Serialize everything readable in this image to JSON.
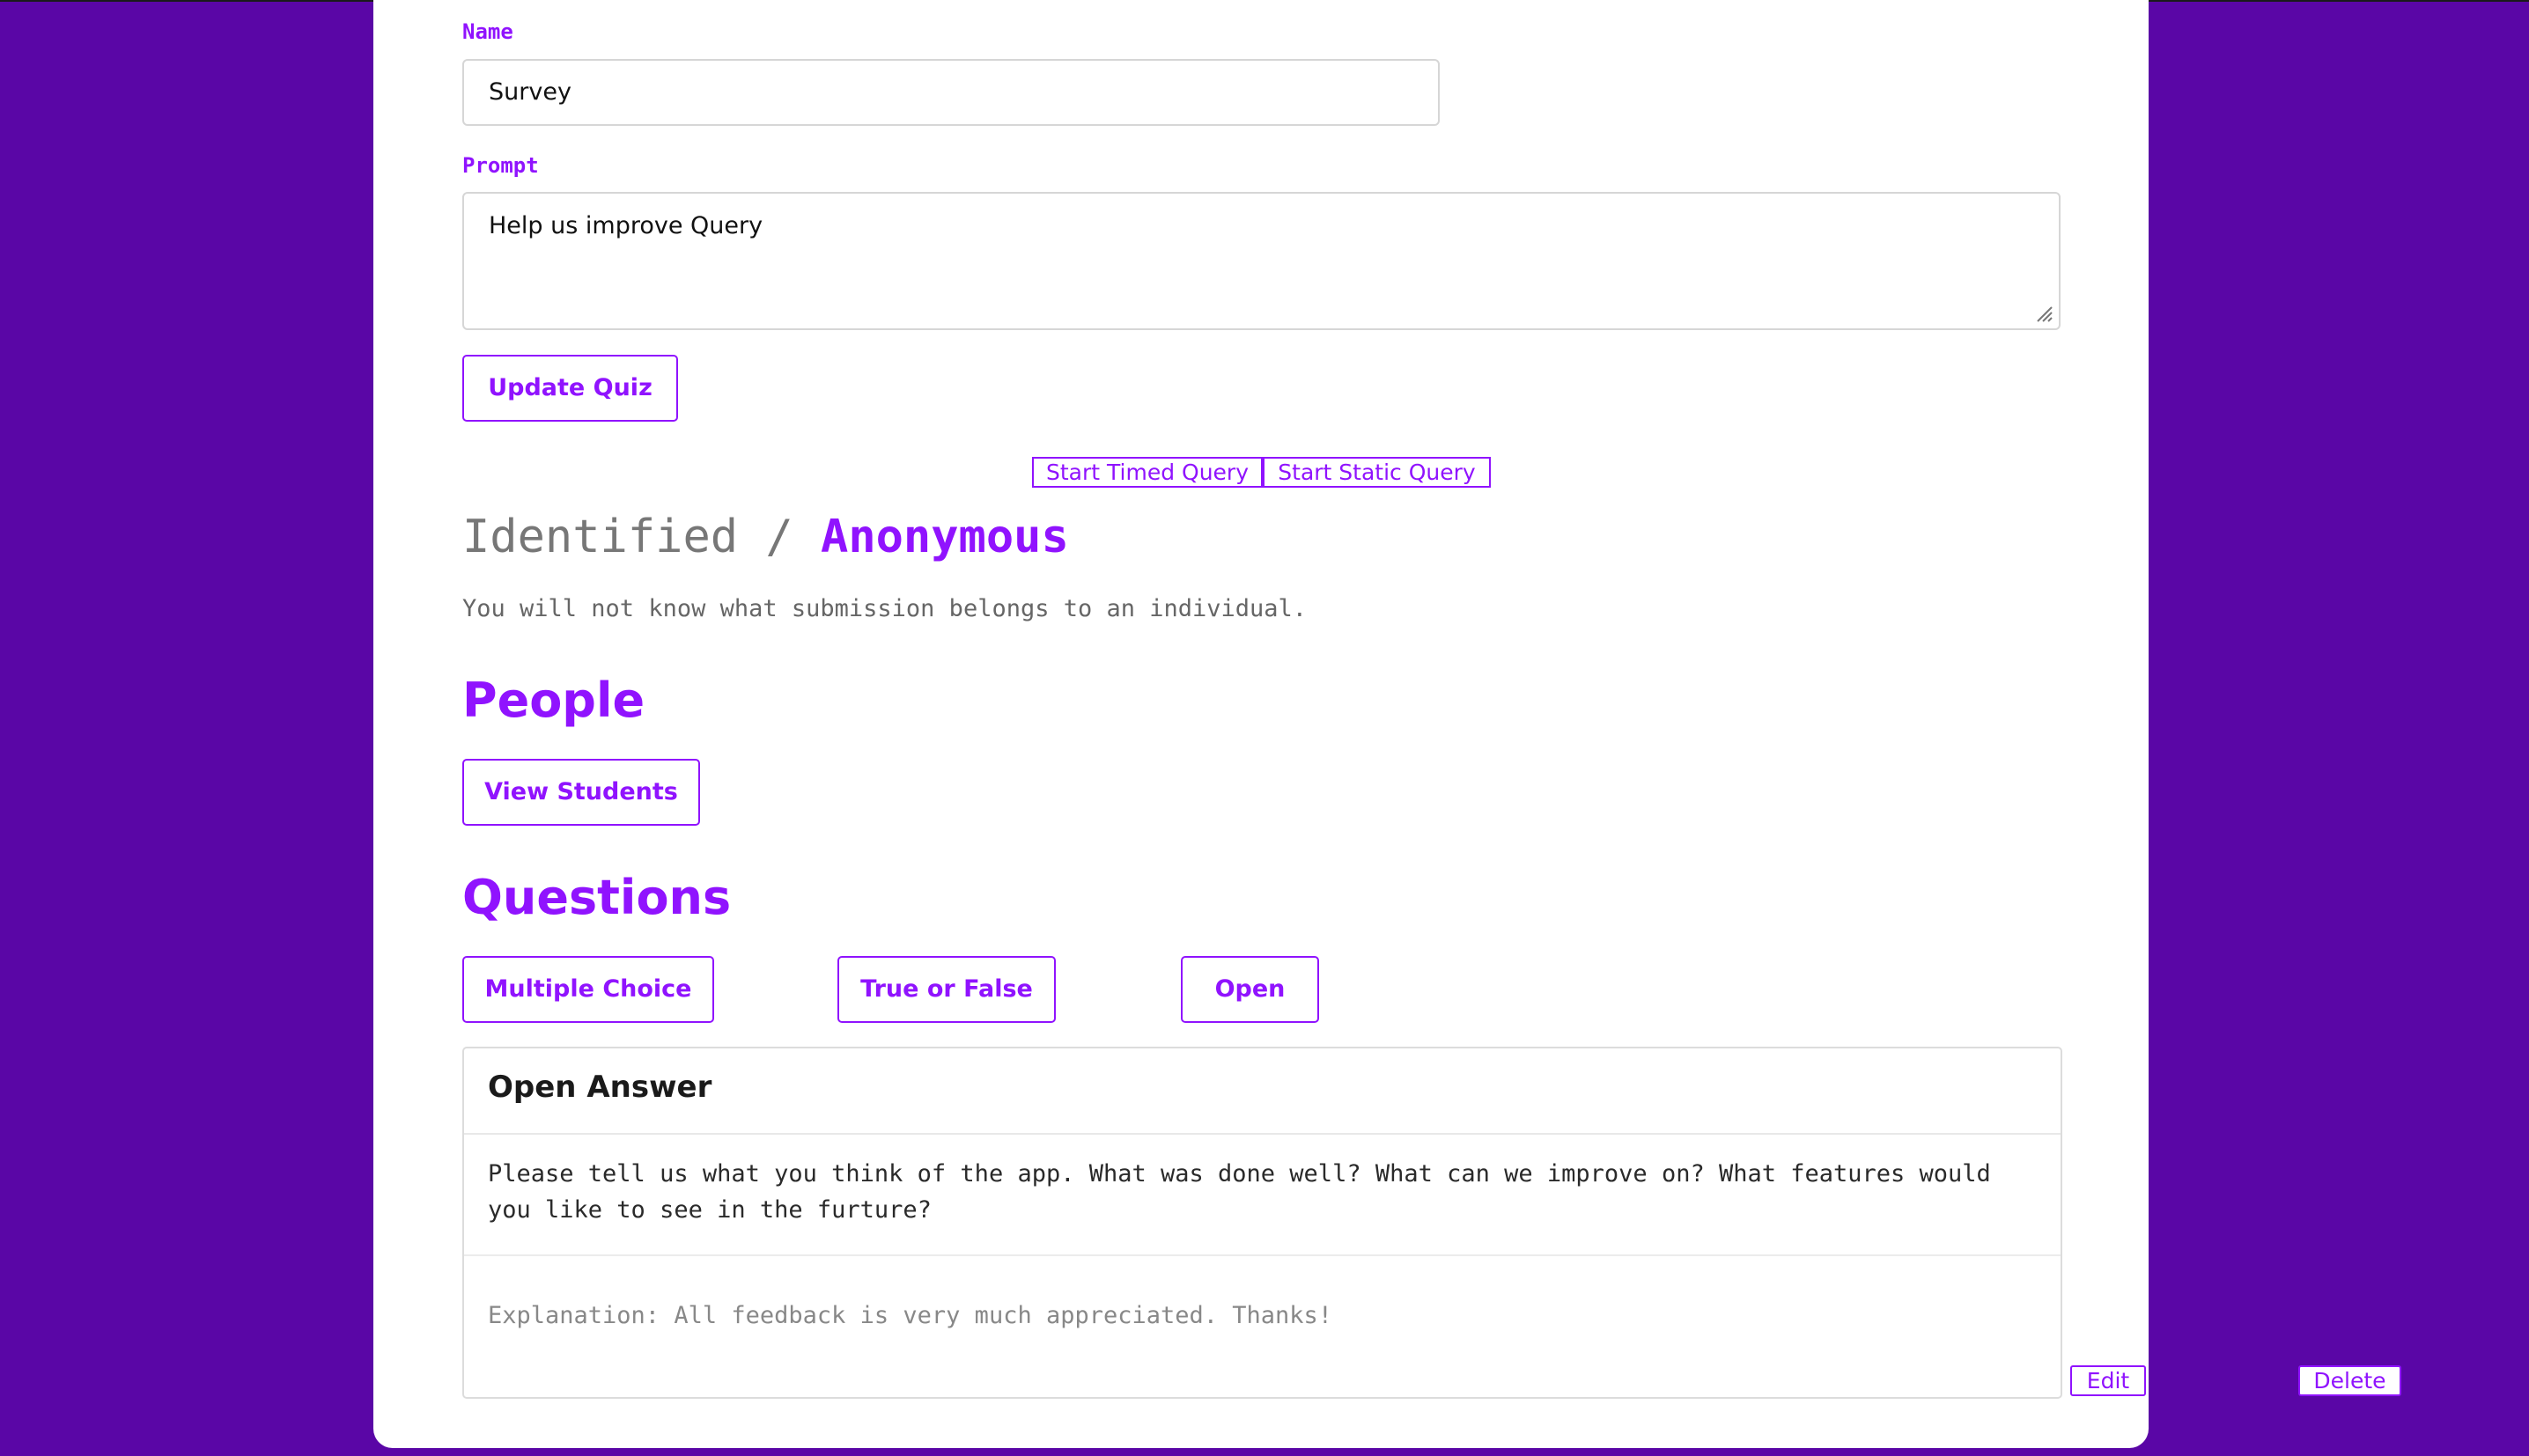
{
  "form": {
    "name_label": "Name",
    "name_value": "Survey",
    "prompt_label": "Prompt",
    "prompt_value": "Help us improve Query",
    "update_button": "Update Quiz"
  },
  "query_controls": {
    "start_timed": "Start Timed Query",
    "start_static": "Start Static Query"
  },
  "privacy": {
    "identified": "Identified",
    "separator": "/",
    "anonymous": "Anonymous",
    "selected": "Anonymous",
    "description": "You will not know what submission belongs to an individual."
  },
  "people": {
    "heading": "People",
    "view_button": "View Students"
  },
  "questions": {
    "heading": "Questions",
    "add_multiple_choice": "Multiple Choice",
    "add_true_false": "True or False",
    "add_open": "Open",
    "items": [
      {
        "type_title": "Open Answer",
        "text": "Please tell us what you think of the app. What was done well? What can we improve on? What features would you like to see in the furture?",
        "explanation": "Explanation: All feedback is very much appreciated. Thanks!",
        "edit_label": "Edit",
        "delete_label": "Delete"
      }
    ]
  },
  "colors": {
    "background": "#5a06a6",
    "accent": "#9013fe",
    "card": "#ffffff"
  }
}
